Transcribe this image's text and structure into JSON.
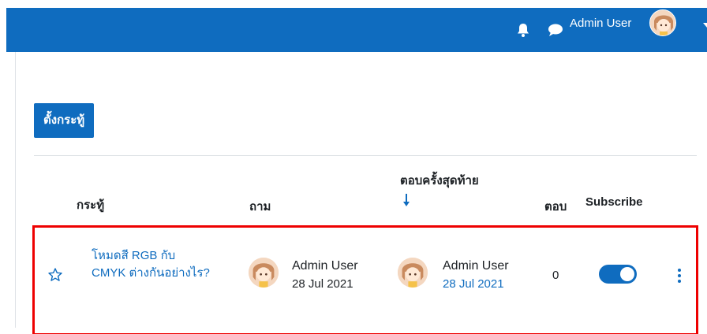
{
  "navbar": {
    "user_name": "Admin User",
    "icons": [
      "bell-icon",
      "chat-icon",
      "caret-down-icon"
    ],
    "color": "#0f6cbf"
  },
  "toolbar": {
    "add_topic_label": "ตั้งกระทู้"
  },
  "table": {
    "headers": {
      "topic": "กระทู้",
      "started_by": "ถาม",
      "last_post": "ตอบครั้งสุดท้าย",
      "replies": "ตอบ",
      "subscribe": "Subscribe"
    },
    "sort_icon": "arrow-down-icon",
    "rows": [
      {
        "title": "โหมดสี RGB กับ CMYK ต่างกันอย่างไร?",
        "started_by": "Admin User",
        "started_date": "28 Jul 2021",
        "last_post_by": "Admin User",
        "last_post_date": "28 Jul 2021",
        "replies": "0",
        "subscribed": true
      }
    ]
  },
  "colors": {
    "accent": "#0f6cbf",
    "highlight": "#ee0000"
  }
}
